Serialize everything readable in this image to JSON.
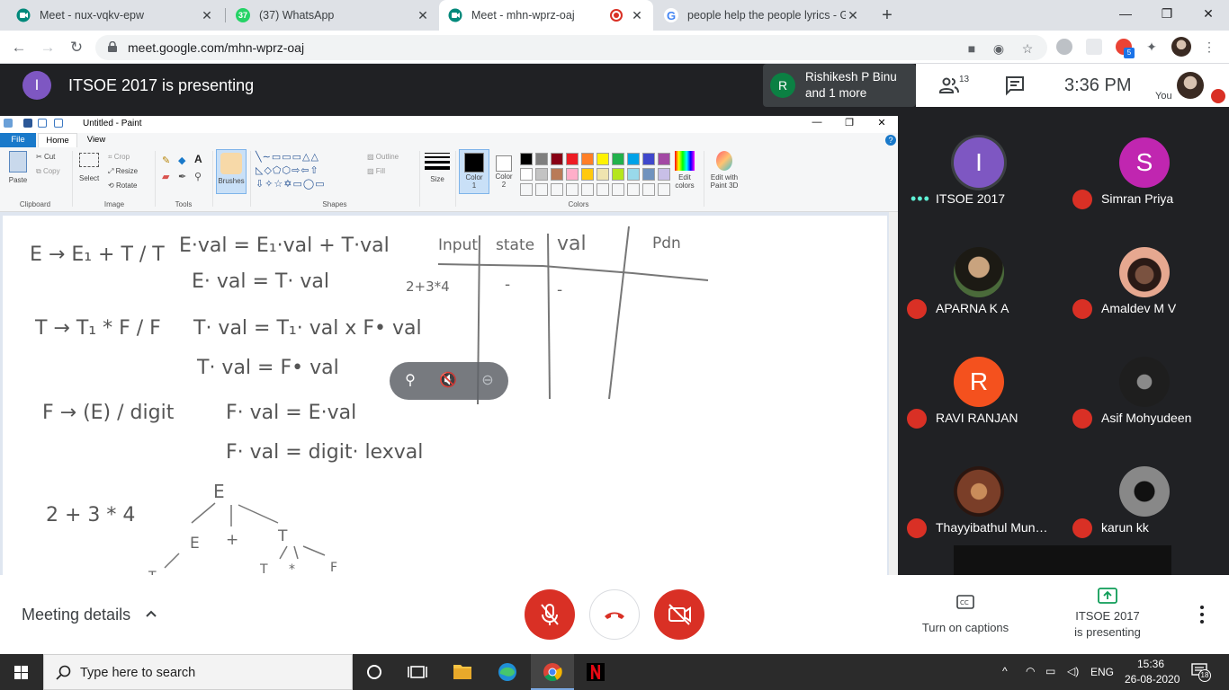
{
  "browser": {
    "tabs": [
      {
        "title": "Meet - nux-vqkv-epw",
        "favicon": "meet-icon"
      },
      {
        "title": "(37) WhatsApp",
        "favicon": "whatsapp-icon",
        "badge": "37"
      },
      {
        "title": "Meet - mhn-wprz-oaj",
        "favicon": "meet-icon",
        "active": true
      },
      {
        "title": "people help the people lyrics - Go",
        "favicon": "google-icon"
      }
    ],
    "url": "meet.google.com/mhn-wprz-oaj",
    "extension_badge": "5"
  },
  "meet": {
    "presenter_initial": "I",
    "presenting_text": "ITSOE 2017 is presenting",
    "active_speaker": {
      "initial": "R",
      "line1": "Rishikesh P Binu",
      "line2": "and 1 more"
    },
    "people_count": "13",
    "time": "3:36  PM",
    "you_label": "You",
    "participants": [
      {
        "name": "ITSOE 2017",
        "initial": "I",
        "color": "#7e57c2",
        "speaking": true
      },
      {
        "name": "Simran Priya",
        "initial": "S",
        "color": "#c026b0",
        "muted": true
      },
      {
        "name": "APARNA K A",
        "photo": true,
        "muted": true
      },
      {
        "name": "Amaldev M V",
        "photo": true,
        "muted": true
      },
      {
        "name": "RAVI RANJAN",
        "initial": "R",
        "color": "#f4511e",
        "muted": true
      },
      {
        "name": "Asif Mohyudeen",
        "photo": true,
        "muted": true
      },
      {
        "name": "Thayyibathul Munav...",
        "photo": true,
        "muted": true
      },
      {
        "name": "karun kk",
        "photo": true,
        "muted": true
      }
    ],
    "bottom": {
      "meeting_details": "Meeting details",
      "captions": "Turn on captions",
      "presenting_line1": "ITSOE 2017",
      "presenting_line2": "is presenting"
    }
  },
  "paint": {
    "window_title": "Untitled - Paint",
    "tabs": {
      "file": "File",
      "home": "Home",
      "view": "View"
    },
    "clipboard": {
      "paste": "Paste",
      "cut": "Cut",
      "copy": "Copy",
      "label": "Clipboard"
    },
    "image": {
      "select": "Select",
      "crop": "Crop",
      "resize": "Resize",
      "rotate": "Rotate",
      "label": "Image"
    },
    "tools_label": "Tools",
    "brushes": "Brushes",
    "shapes": {
      "outline": "Outline",
      "fill": "Fill",
      "label": "Shapes"
    },
    "size": "Size",
    "color1": "Color\n1",
    "color2": "Color\n2",
    "colors_label": "Colors",
    "edit_colors": "Edit colors",
    "edit_paint3d": "Edit with Paint 3D",
    "palette_row1": [
      "#000000",
      "#7f7f7f",
      "#880015",
      "#ed1c24",
      "#ff7f27",
      "#fff200",
      "#22b14c",
      "#00a2e8",
      "#3f48cc",
      "#a349a4"
    ],
    "palette_row2": [
      "#ffffff",
      "#c3c3c3",
      "#b97a57",
      "#ffaec9",
      "#ffc90e",
      "#efe4b0",
      "#b5e61d",
      "#99d9ea",
      "#7092be",
      "#c8bfe7"
    ],
    "handwriting": {
      "g1a": "E → E₁ + T / T",
      "g1b": "E·val = E₁·val + T·val",
      "g1c": "E· val = T· val",
      "g2a": "T → T₁ * F / F",
      "g2b": "T· val = T₁· val x F• val",
      "g2c": "T· val = F• val",
      "g3a": "F → (E) / digit",
      "g3b": "F· val = E·val",
      "g3c": "F· val = digit· lexval",
      "expr": "2 + 3 * 4",
      "t_input": "Input",
      "t_state": "state",
      "t_val": "val",
      "t_pdn": "Pdn",
      "t_row": "2+3*4",
      "t_dash1": "-",
      "t_dash2": "-",
      "tree_E": "E",
      "tree_E2": "E",
      "tree_plus": "+",
      "tree_T": "T",
      "tree_T2": "T",
      "tree_star": "*",
      "tree_F": "F",
      "tree_T3": "T"
    }
  },
  "taskbar": {
    "search_placeholder": "Type here to search",
    "lang": "ENG",
    "time": "15:36",
    "date": "26-08-2020",
    "notifications": "18"
  }
}
